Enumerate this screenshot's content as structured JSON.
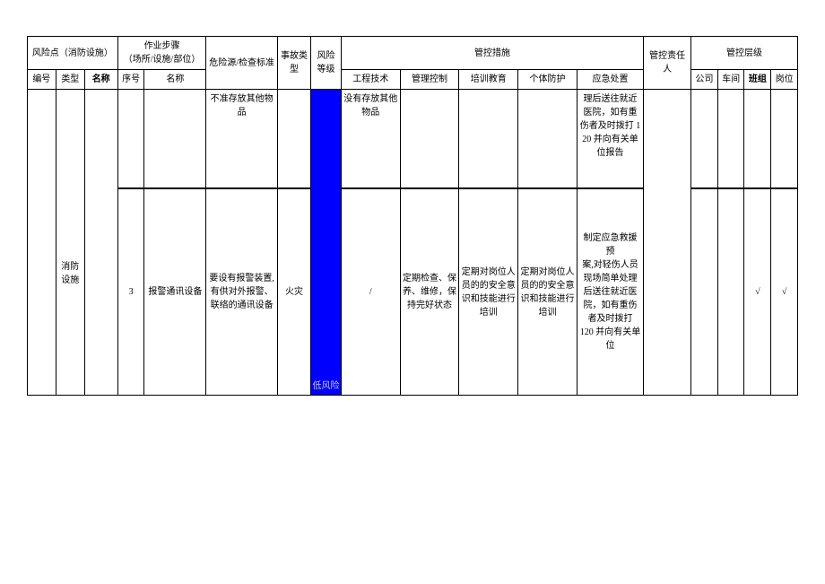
{
  "header": {
    "risk_point_group": "风险点（消防设施）",
    "work_step_group": "作业步骤\n（场所/设施/部位）",
    "hazard_check": "危险源/检查标准",
    "accident_type": "事故类型",
    "risk_level": "风险等级",
    "control_measures_group": "管控措施",
    "control_responsible": "管控责任人",
    "control_layer_group": "管控层级",
    "cols": {
      "id": "编号",
      "category": "类型",
      "name": "名称",
      "seq": "序号",
      "step_name": "名称",
      "engineering": "工程技术",
      "management": "管理控制",
      "training": "培训教育",
      "ppe": "个体防护",
      "emergency": "应急处置",
      "company": "公司",
      "workshop": "车间",
      "team": "班组",
      "post": "岗位"
    }
  },
  "rows": [
    {
      "hazard_check": "不准存放其他物品",
      "engineering": "没有存放其他物品",
      "emergency": "理后送往就近医院，如有重伤者及时拨打 120 并向有关单位报告"
    },
    {
      "category": "消防设施",
      "seq": "3",
      "step_name": "报警通讯设备",
      "hazard_check": "要设有报警装置,有供对外报警、联络的通讯设备",
      "accident_type": "火灾",
      "risk_level_label": "低风险",
      "engineering": "/",
      "management": "定期检查、保养、维修，保持完好状态",
      "training": "定期对岗位人员的的安全意识和技能进行培训",
      "ppe": "定期对岗位人员的的安全意识和技能进行培训",
      "emergency": "制定应急救援预\n案,对轻伤人员现场简单处理后送往就近医院，如有重伤者及时拨打\n120 并向有关单位",
      "team": "√",
      "post": "√"
    }
  ]
}
